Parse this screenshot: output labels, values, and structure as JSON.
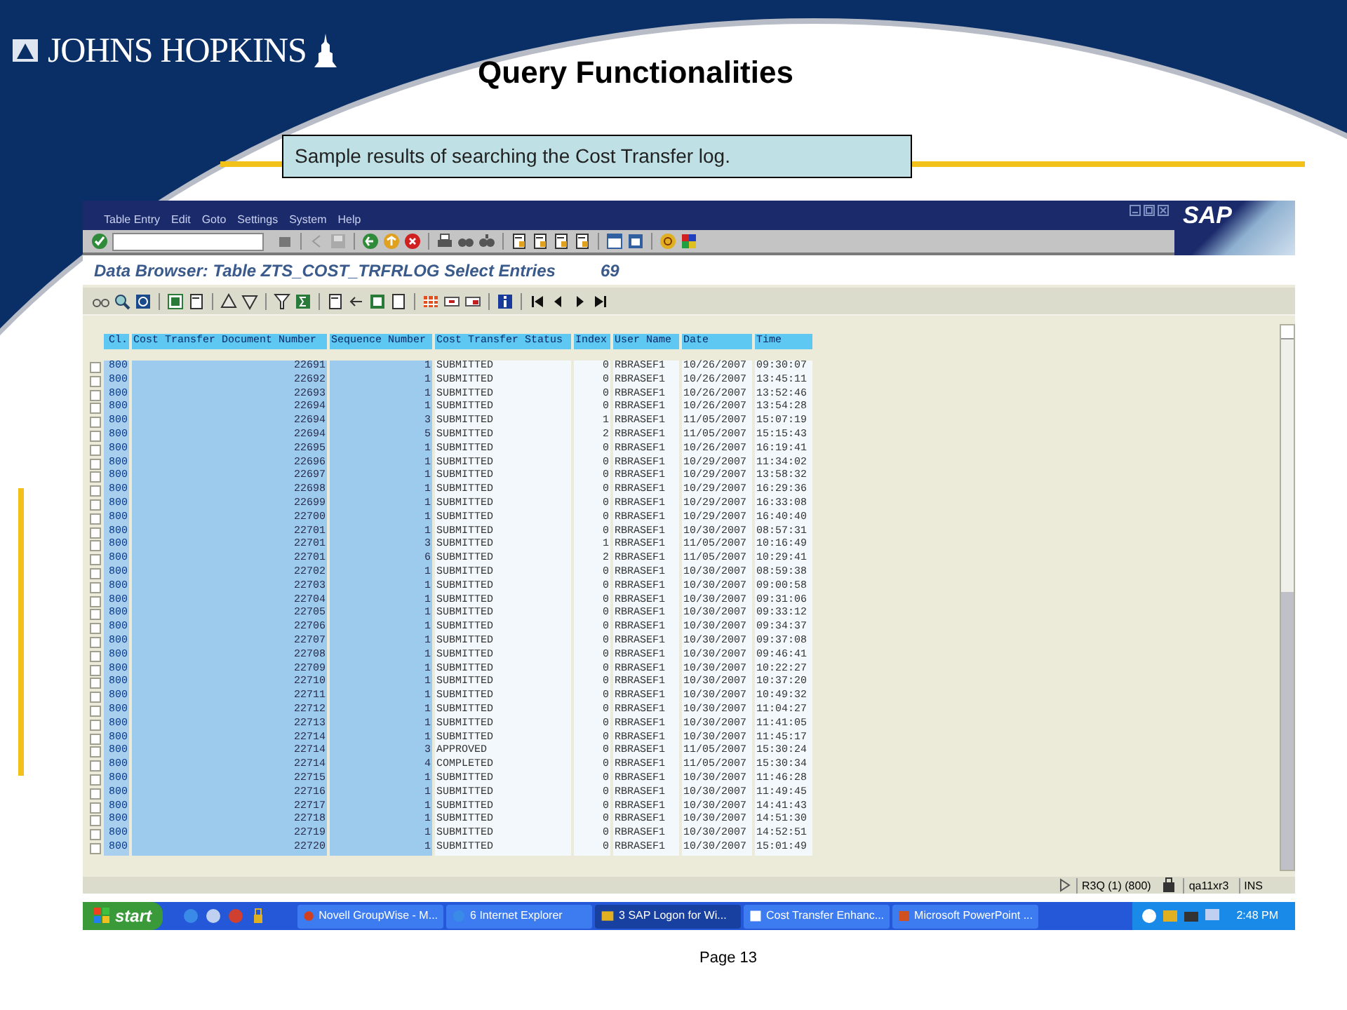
{
  "slide": {
    "logo": "JOHNS HOPKINS",
    "title": "Query Functionalities",
    "caption": "Sample results of searching the Cost Transfer log.",
    "page": "Page 13"
  },
  "sap": {
    "menu": [
      "Table Entry",
      "Edit",
      "Goto",
      "Settings",
      "System",
      "Help"
    ],
    "logo": "SAP",
    "title": "Data Browser: Table ZTS_COST_TRFRLOG Select Entries",
    "count": "69",
    "table": {
      "columns": [
        "Cl.",
        "Cost Transfer Document Number",
        "Sequence Number",
        "Cost Transfer Status",
        "Index",
        "User Name",
        "Date",
        "Time"
      ],
      "rows": [
        {
          "checked": false,
          "cells": [
            "800",
            "22691",
            "1",
            "SUBMITTED",
            "0",
            "RBRASEF1",
            "10/26/2007",
            "09:30:07"
          ]
        },
        {
          "checked": false,
          "cells": [
            "800",
            "22692",
            "1",
            "SUBMITTED",
            "0",
            "RBRASEF1",
            "10/26/2007",
            "13:45:11"
          ]
        },
        {
          "checked": false,
          "cells": [
            "800",
            "22693",
            "1",
            "SUBMITTED",
            "0",
            "RBRASEF1",
            "10/26/2007",
            "13:52:46"
          ]
        },
        {
          "checked": false,
          "cells": [
            "800",
            "22694",
            "1",
            "SUBMITTED",
            "0",
            "RBRASEF1",
            "10/26/2007",
            "13:54:28"
          ]
        },
        {
          "checked": false,
          "cells": [
            "800",
            "22694",
            "3",
            "SUBMITTED",
            "1",
            "RBRASEF1",
            "11/05/2007",
            "15:07:19"
          ]
        },
        {
          "checked": false,
          "cells": [
            "800",
            "22694",
            "5",
            "SUBMITTED",
            "2",
            "RBRASEF1",
            "11/05/2007",
            "15:15:43"
          ]
        },
        {
          "checked": false,
          "cells": [
            "800",
            "22695",
            "1",
            "SUBMITTED",
            "0",
            "RBRASEF1",
            "10/26/2007",
            "16:19:41"
          ]
        },
        {
          "checked": false,
          "cells": [
            "800",
            "22696",
            "1",
            "SUBMITTED",
            "0",
            "RBRASEF1",
            "10/29/2007",
            "11:34:02"
          ]
        },
        {
          "checked": false,
          "cells": [
            "800",
            "22697",
            "1",
            "SUBMITTED",
            "0",
            "RBRASEF1",
            "10/29/2007",
            "13:58:32"
          ]
        },
        {
          "checked": false,
          "cells": [
            "800",
            "22698",
            "1",
            "SUBMITTED",
            "0",
            "RBRASEF1",
            "10/29/2007",
            "16:29:36"
          ]
        },
        {
          "checked": false,
          "cells": [
            "800",
            "22699",
            "1",
            "SUBMITTED",
            "0",
            "RBRASEF1",
            "10/29/2007",
            "16:33:08"
          ]
        },
        {
          "checked": false,
          "cells": [
            "800",
            "22700",
            "1",
            "SUBMITTED",
            "0",
            "RBRASEF1",
            "10/29/2007",
            "16:40:40"
          ]
        },
        {
          "checked": false,
          "cells": [
            "800",
            "22701",
            "1",
            "SUBMITTED",
            "0",
            "RBRASEF1",
            "10/30/2007",
            "08:57:31"
          ]
        },
        {
          "checked": false,
          "cells": [
            "800",
            "22701",
            "3",
            "SUBMITTED",
            "1",
            "RBRASEF1",
            "11/05/2007",
            "10:16:49"
          ]
        },
        {
          "checked": false,
          "cells": [
            "800",
            "22701",
            "6",
            "SUBMITTED",
            "2",
            "RBRASEF1",
            "11/05/2007",
            "10:29:41"
          ]
        },
        {
          "checked": false,
          "cells": [
            "800",
            "22702",
            "1",
            "SUBMITTED",
            "0",
            "RBRASEF1",
            "10/30/2007",
            "08:59:38"
          ]
        },
        {
          "checked": false,
          "cells": [
            "800",
            "22703",
            "1",
            "SUBMITTED",
            "0",
            "RBRASEF1",
            "10/30/2007",
            "09:00:58"
          ]
        },
        {
          "checked": false,
          "cells": [
            "800",
            "22704",
            "1",
            "SUBMITTED",
            "0",
            "RBRASEF1",
            "10/30/2007",
            "09:31:06"
          ]
        },
        {
          "checked": false,
          "cells": [
            "800",
            "22705",
            "1",
            "SUBMITTED",
            "0",
            "RBRASEF1",
            "10/30/2007",
            "09:33:12"
          ]
        },
        {
          "checked": false,
          "cells": [
            "800",
            "22706",
            "1",
            "SUBMITTED",
            "0",
            "RBRASEF1",
            "10/30/2007",
            "09:34:37"
          ]
        },
        {
          "checked": false,
          "cells": [
            "800",
            "22707",
            "1",
            "SUBMITTED",
            "0",
            "RBRASEF1",
            "10/30/2007",
            "09:37:08"
          ]
        },
        {
          "checked": false,
          "cells": [
            "800",
            "22708",
            "1",
            "SUBMITTED",
            "0",
            "RBRASEF1",
            "10/30/2007",
            "09:46:41"
          ]
        },
        {
          "checked": false,
          "cells": [
            "800",
            "22709",
            "1",
            "SUBMITTED",
            "0",
            "RBRASEF1",
            "10/30/2007",
            "10:22:27"
          ]
        },
        {
          "checked": false,
          "cells": [
            "800",
            "22710",
            "1",
            "SUBMITTED",
            "0",
            "RBRASEF1",
            "10/30/2007",
            "10:37:20"
          ]
        },
        {
          "checked": false,
          "cells": [
            "800",
            "22711",
            "1",
            "SUBMITTED",
            "0",
            "RBRASEF1",
            "10/30/2007",
            "10:49:32"
          ]
        },
        {
          "checked": false,
          "cells": [
            "800",
            "22712",
            "1",
            "SUBMITTED",
            "0",
            "RBRASEF1",
            "10/30/2007",
            "11:04:27"
          ]
        },
        {
          "checked": false,
          "cells": [
            "800",
            "22713",
            "1",
            "SUBMITTED",
            "0",
            "RBRASEF1",
            "10/30/2007",
            "11:41:05"
          ]
        },
        {
          "checked": false,
          "cells": [
            "800",
            "22714",
            "1",
            "SUBMITTED",
            "0",
            "RBRASEF1",
            "10/30/2007",
            "11:45:17"
          ]
        },
        {
          "checked": false,
          "cells": [
            "800",
            "22714",
            "3",
            "APPROVED",
            "0",
            "RBRASEF1",
            "11/05/2007",
            "15:30:24"
          ]
        },
        {
          "checked": false,
          "cells": [
            "800",
            "22714",
            "4",
            "COMPLETED",
            "0",
            "RBRASEF1",
            "11/05/2007",
            "15:30:34"
          ]
        },
        {
          "checked": false,
          "cells": [
            "800",
            "22715",
            "1",
            "SUBMITTED",
            "0",
            "RBRASEF1",
            "10/30/2007",
            "11:46:28"
          ]
        },
        {
          "checked": false,
          "cells": [
            "800",
            "22716",
            "1",
            "SUBMITTED",
            "0",
            "RBRASEF1",
            "10/30/2007",
            "11:49:45"
          ]
        },
        {
          "checked": false,
          "cells": [
            "800",
            "22717",
            "1",
            "SUBMITTED",
            "0",
            "RBRASEF1",
            "10/30/2007",
            "14:41:43"
          ]
        },
        {
          "checked": false,
          "cells": [
            "800",
            "22718",
            "1",
            "SUBMITTED",
            "0",
            "RBRASEF1",
            "10/30/2007",
            "14:51:30"
          ]
        },
        {
          "checked": false,
          "cells": [
            "800",
            "22719",
            "1",
            "SUBMITTED",
            "0",
            "RBRASEF1",
            "10/30/2007",
            "14:52:51"
          ]
        },
        {
          "checked": false,
          "cells": [
            "800",
            "22720",
            "1",
            "SUBMITTED",
            "0",
            "RBRASEF1",
            "10/30/2007",
            "15:01:49"
          ]
        }
      ]
    },
    "status_bar": [
      "R3Q (1) (800)",
      "qa11xr3",
      "INS"
    ]
  },
  "taskbar": {
    "start": "start",
    "tasks": [
      {
        "label": "Novell GroupWise - M...",
        "selected": false
      },
      {
        "label": "6 Internet Explorer",
        "selected": false
      },
      {
        "label": "3 SAP Logon for Wi...",
        "selected": true
      },
      {
        "label": "Cost Transfer Enhanc...",
        "selected": false
      },
      {
        "label": "Microsoft PowerPoint ...",
        "selected": false
      }
    ],
    "clock": "2:48 PM"
  }
}
